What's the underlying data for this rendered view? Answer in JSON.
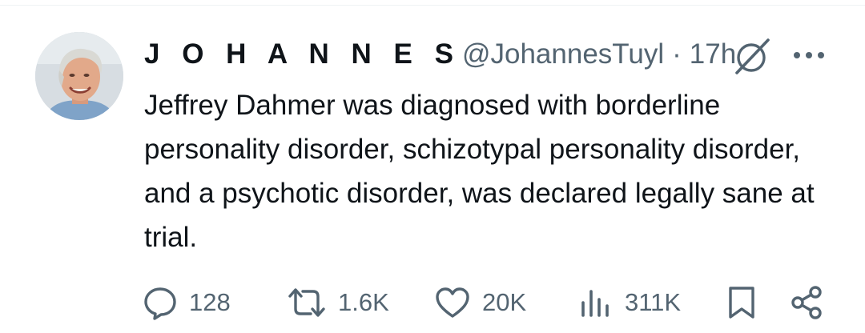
{
  "tweet": {
    "display_name": "J O H A N N E S",
    "handle": "@JohannesTuyl",
    "separator": "·",
    "timestamp": "17h",
    "text": "Jeffrey Dahmer was diagnosed with borderline personality disorder, schizotypal personality disorder, and a psychotic disorder, was declared legally sane at trial."
  },
  "icons": {
    "avatar": "avatar-photo",
    "grok": "grok-icon",
    "more": "more-icon",
    "reply": "reply-icon",
    "retweet": "retweet-icon",
    "like": "heart-icon",
    "views": "views-icon",
    "bookmark": "bookmark-icon",
    "share": "share-icon"
  },
  "actions": {
    "replies": "128",
    "reposts": "1.6K",
    "likes": "20K",
    "views": "311K"
  },
  "colors": {
    "text_primary": "#0f1419",
    "text_secondary": "#536471",
    "divider": "#eff3f4"
  }
}
